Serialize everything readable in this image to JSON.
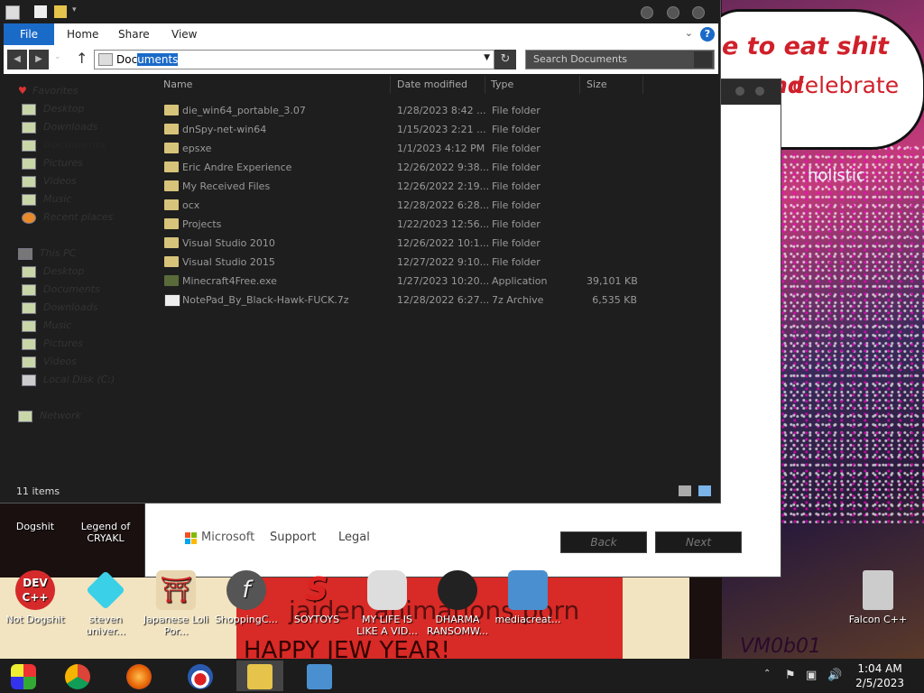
{
  "desktop": {
    "speech_line1": "e to eat shit",
    "speech_line2_part1": "nd",
    "speech_line2_part2": "celebrate",
    "wall_text_holistic": "holistic",
    "banner_text": "jaiden animations porn",
    "banner_text2": "HAPPY JEW YEAR!",
    "vm_text": "VM0b01",
    "icons": [
      {
        "label": "Dogshit"
      },
      {
        "label": "Legend of CRYAKL"
      },
      {
        "label": "Not Dogshit"
      },
      {
        "label": "steven univer..."
      },
      {
        "label": "Japanese Loli Por..."
      },
      {
        "label": "ShoppingC..."
      },
      {
        "label": "SOYTOYS"
      },
      {
        "label": "MY LIFE IS LIKE A VID..."
      },
      {
        "label": "DHARMA RANSOMW..."
      },
      {
        "label": "mediacreat..."
      },
      {
        "label": "Falcon C++"
      }
    ],
    "devcpp_text": "DEV C++"
  },
  "setup_dialog": {
    "brand": "Microsoft",
    "support_link": "Support",
    "legal_link": "Legal",
    "back_button": "Back",
    "next_button": "Next"
  },
  "explorer": {
    "ribbon": {
      "file": "File",
      "home": "Home",
      "share": "Share",
      "view": "View"
    },
    "address": {
      "prefix": "Doc",
      "selected": "uments"
    },
    "search_placeholder": "Search Documents",
    "nav": {
      "favorites": "Favorites",
      "favorites_items": [
        "Desktop",
        "Downloads",
        "Documents",
        "Pictures",
        "Videos",
        "Music",
        "Recent places"
      ],
      "this_pc": "This PC",
      "pc_items": [
        "Desktop",
        "Documents",
        "Downloads",
        "Music",
        "Pictures",
        "Videos",
        "Local Disk (C:)"
      ],
      "network": "Network"
    },
    "columns": {
      "name": "Name",
      "date": "Date modified",
      "type": "Type",
      "size": "Size"
    },
    "files": [
      {
        "name": "die_win64_portable_3.07",
        "date": "1/28/2023 8:42 ...",
        "type": "File folder",
        "size": "",
        "kind": "folder"
      },
      {
        "name": "dnSpy-net-win64",
        "date": "1/15/2023 2:21 ...",
        "type": "File folder",
        "size": "",
        "kind": "folder"
      },
      {
        "name": "epsxe",
        "date": "1/1/2023 4:12 PM",
        "type": "File folder",
        "size": "",
        "kind": "folder"
      },
      {
        "name": "Eric Andre Experience",
        "date": "12/26/2022 9:38...",
        "type": "File folder",
        "size": "",
        "kind": "folder"
      },
      {
        "name": "My Received Files",
        "date": "12/26/2022 2:19...",
        "type": "File folder",
        "size": "",
        "kind": "folder"
      },
      {
        "name": "ocx",
        "date": "12/28/2022 6:28...",
        "type": "File folder",
        "size": "",
        "kind": "folder"
      },
      {
        "name": "Projects",
        "date": "1/22/2023 12:56...",
        "type": "File folder",
        "size": "",
        "kind": "folder"
      },
      {
        "name": "Visual Studio 2010",
        "date": "12/26/2022 10:1...",
        "type": "File folder",
        "size": "",
        "kind": "folder"
      },
      {
        "name": "Visual Studio 2015",
        "date": "12/27/2022 9:10...",
        "type": "File folder",
        "size": "",
        "kind": "folder"
      },
      {
        "name": "Minecraft4Free.exe",
        "date": "1/27/2023 10:20...",
        "type": "Application",
        "size": "39,101 KB",
        "kind": "exe"
      },
      {
        "name": "NotePad_By_Black-Hawk-FUCK.7z",
        "date": "12/28/2022 6:27...",
        "type": "7z Archive",
        "size": "6,535 KB",
        "kind": "archive"
      }
    ],
    "status": "11 items"
  },
  "taskbar": {
    "time": "1:04 AM",
    "date": "2/5/2023"
  },
  "colors": {
    "accent": "#1a6ac8",
    "explorer_bg": "#1e1e1e",
    "folder": "#d7c37a",
    "banner_red": "#d82a26"
  }
}
